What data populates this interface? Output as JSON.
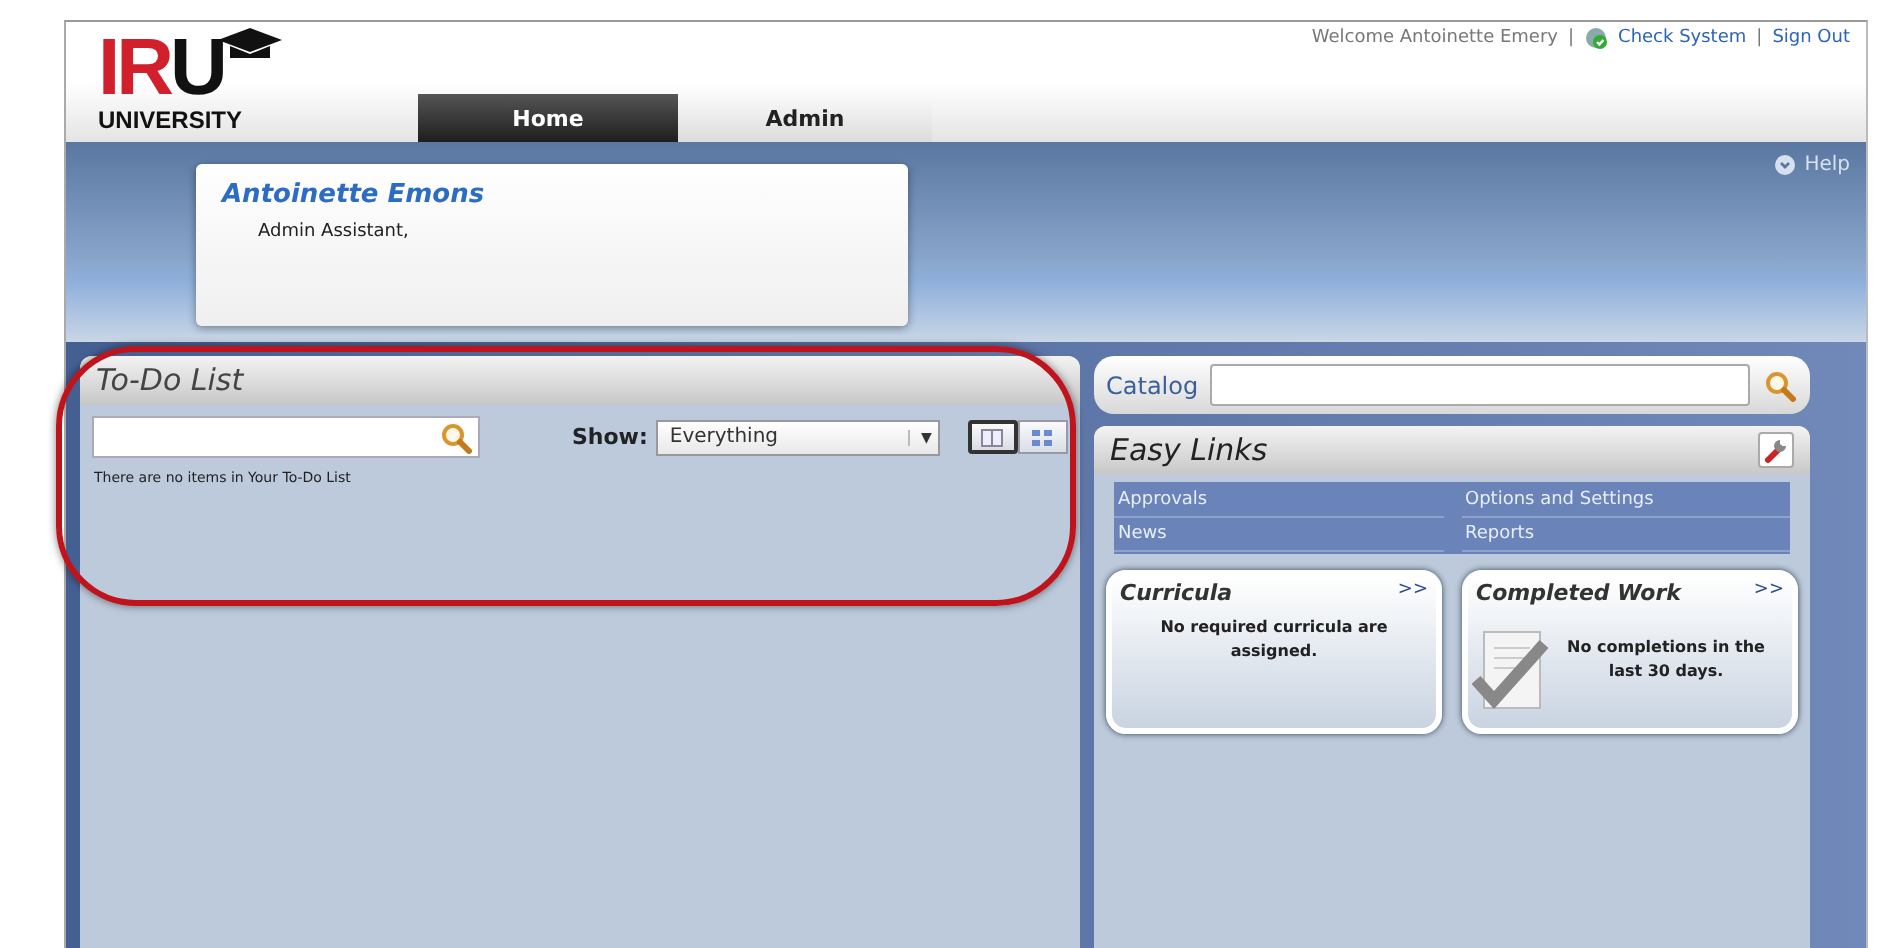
{
  "logo": {
    "letters": "IR",
    "mark": "U",
    "subtitle": "UNIVERSITY"
  },
  "top_bar": {
    "welcome": "Welcome Antoinette Emery",
    "separator": "|",
    "links": [
      "Check System",
      "Sign Out"
    ]
  },
  "tabs": [
    {
      "label": "Home",
      "selected": true
    },
    {
      "label": "Admin",
      "selected": false
    }
  ],
  "help": "Help",
  "profile": {
    "name": "Antoinette Emons",
    "role": "Admin Assistant,"
  },
  "todo": {
    "title": "To-Do List",
    "show_label": "Show:",
    "show_value": "Everything",
    "dropdown_arrow": "▼",
    "empty_message": "There are no items in Your To-Do List",
    "views": [
      {
        "kind": "list",
        "selected": true
      },
      {
        "kind": "grid",
        "selected": false
      }
    ]
  },
  "catalog": {
    "label": "Catalog"
  },
  "easy_links": {
    "title": "Easy Links",
    "links": [
      "Approvals",
      "Options and Settings",
      "News",
      "Reports"
    ]
  },
  "widgets": [
    {
      "kind": "plain",
      "title": "Curricula",
      "more": ">>",
      "message": "No required curricula are assigned."
    },
    {
      "kind": "checklist",
      "title": "Completed Work",
      "more": ">>",
      "message": "No completions in the last 30 days."
    }
  ]
}
